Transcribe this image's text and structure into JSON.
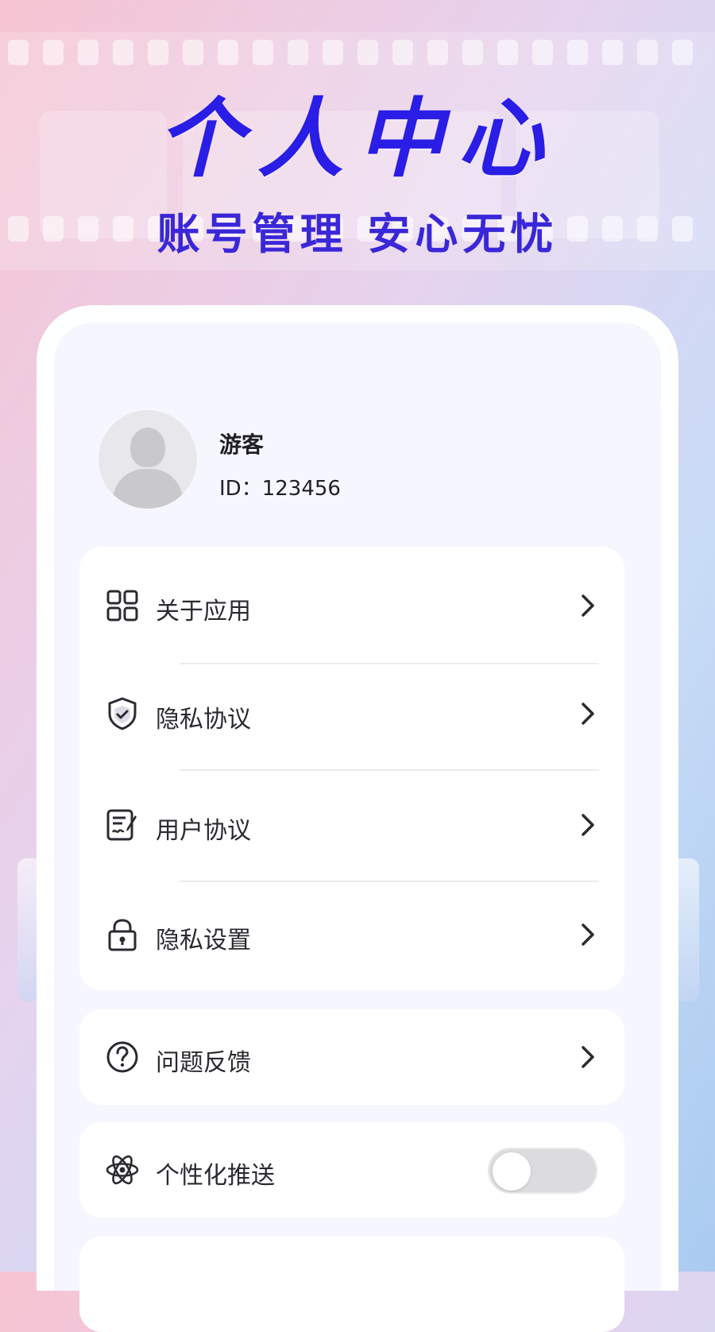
{
  "hero": {
    "title": "个人中心",
    "subtitle": "账号管理 安心无忧"
  },
  "profile": {
    "name": "游客",
    "id_text": "ID：123456",
    "avatar_icon": "user-silhouette-icon"
  },
  "menu_group_1": [
    {
      "label": "关于应用",
      "icon": "grid-apps-icon"
    },
    {
      "label": "隐私协议",
      "icon": "shield-check-icon"
    },
    {
      "label": "用户协议",
      "icon": "document-sign-icon"
    },
    {
      "label": "隐私设置",
      "icon": "lock-icon"
    }
  ],
  "menu_feedback": {
    "label": "问题反馈",
    "icon": "question-circle-icon"
  },
  "menu_push": {
    "label": "个性化推送",
    "icon": "atom-icon",
    "toggle_on": false
  },
  "colors": {
    "accent": "#2a1de6",
    "card_bg": "#f6f7fe",
    "panel_bg": "#ffffff",
    "text": "#2a2a30"
  }
}
